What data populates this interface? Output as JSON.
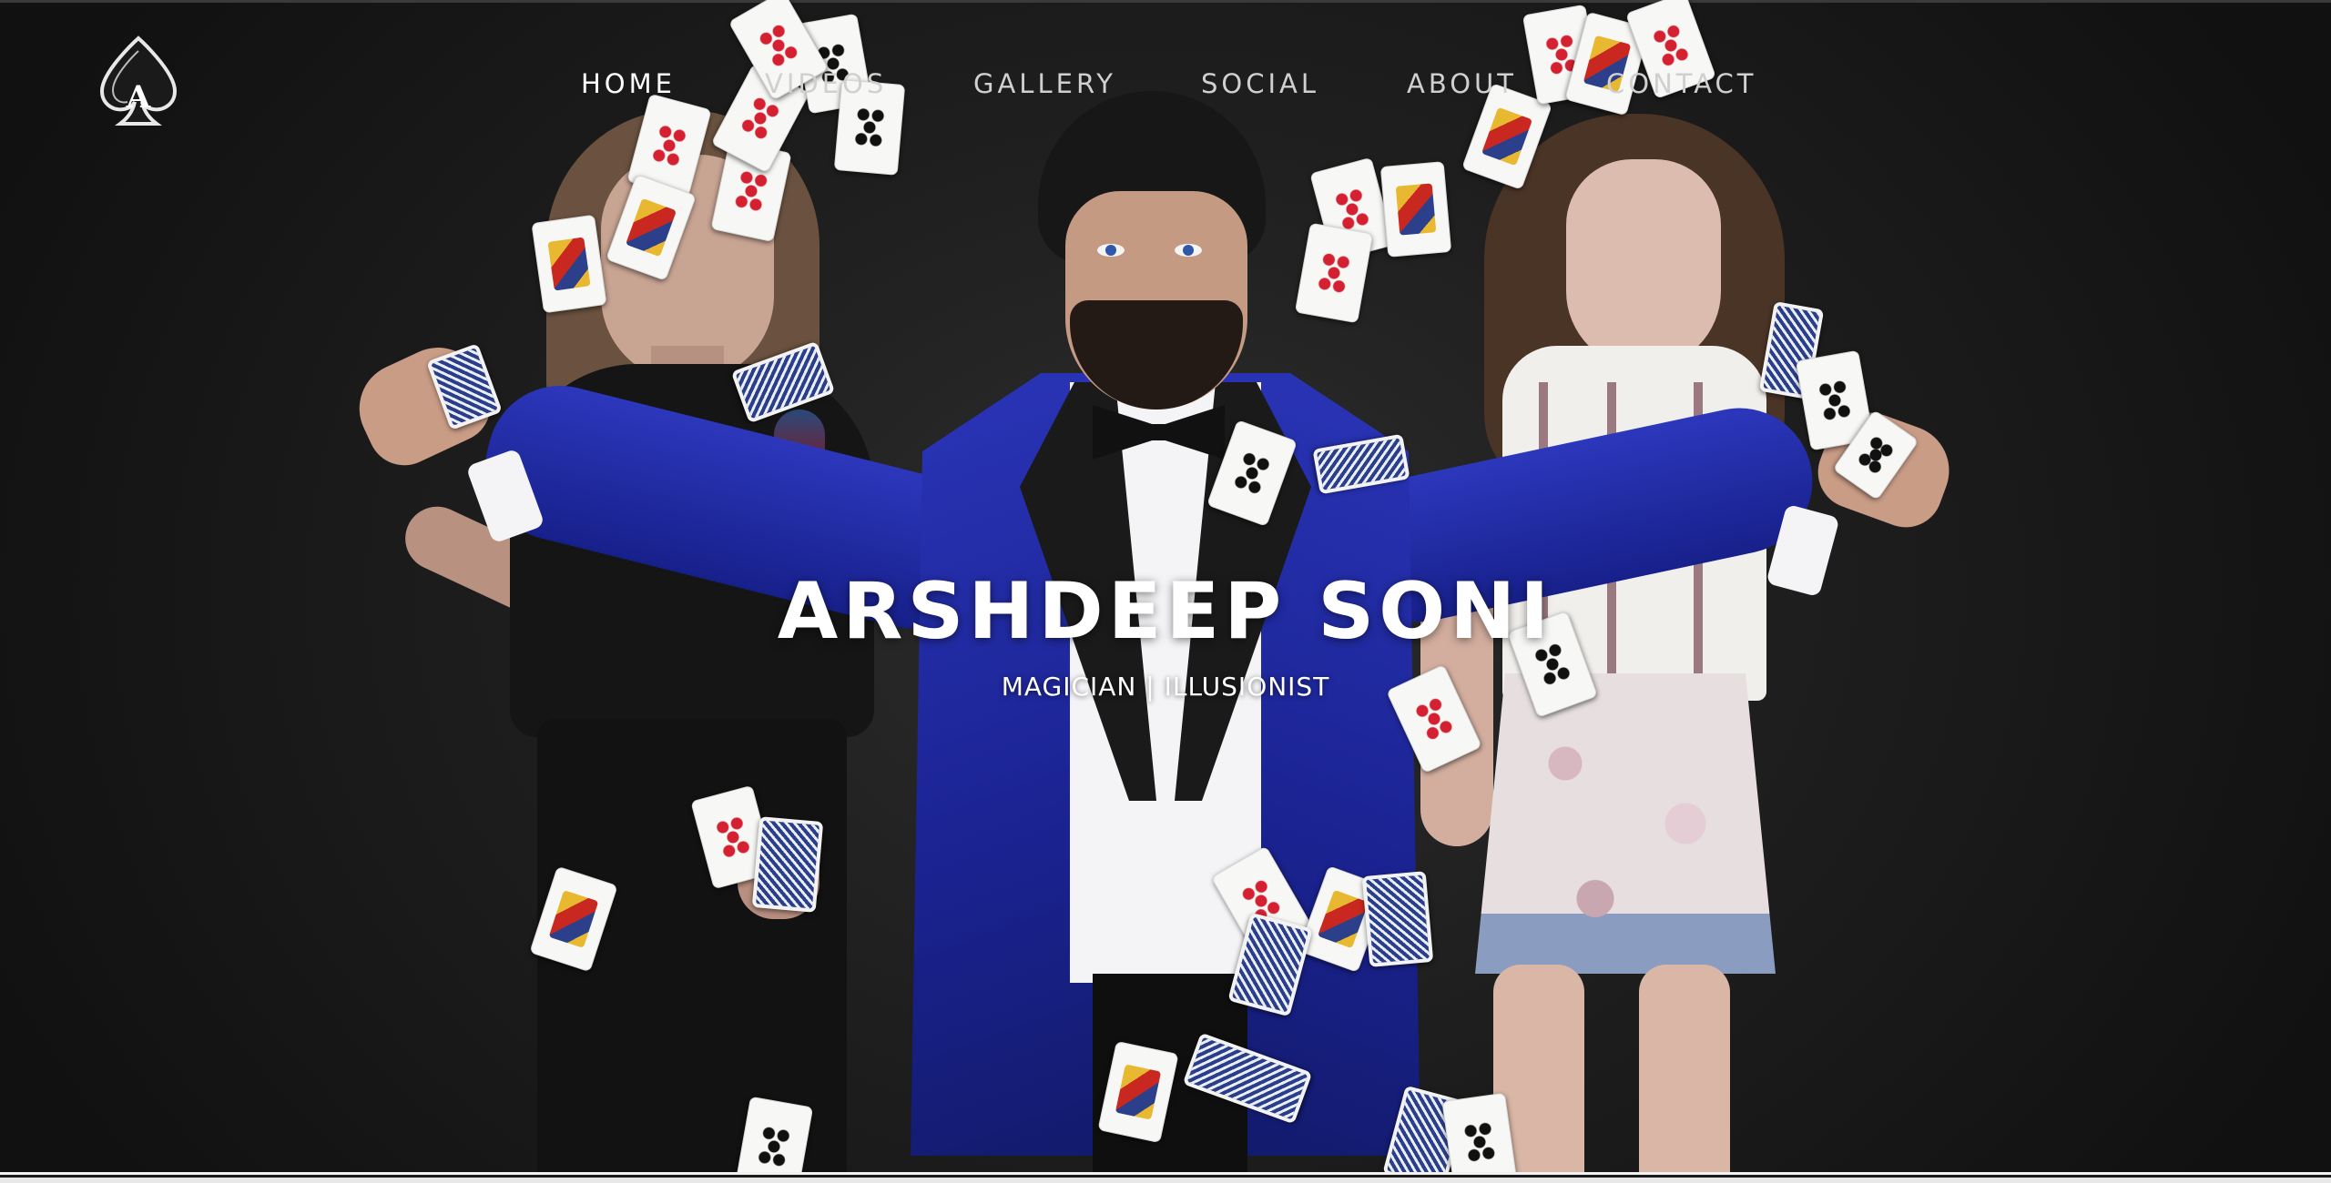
{
  "site": {
    "logo_icon": "ace-of-spades-icon"
  },
  "nav": {
    "items": [
      {
        "label": "HOME",
        "active": true
      },
      {
        "label": "VIDEOS",
        "active": false
      },
      {
        "label": "GALLERY",
        "active": false
      },
      {
        "label": "SOCIAL",
        "active": false
      },
      {
        "label": "ABOUT",
        "active": false
      },
      {
        "label": "CONTACT",
        "active": false
      }
    ]
  },
  "hero": {
    "title": "ARSHDEEP SONI",
    "subtitle": "MAGICIAN | ILLUSIONIST"
  },
  "colors": {
    "background": "#141414",
    "jacket": "#1a2290",
    "nav_text": "#d0d0d0",
    "nav_active": "#ffffff"
  }
}
